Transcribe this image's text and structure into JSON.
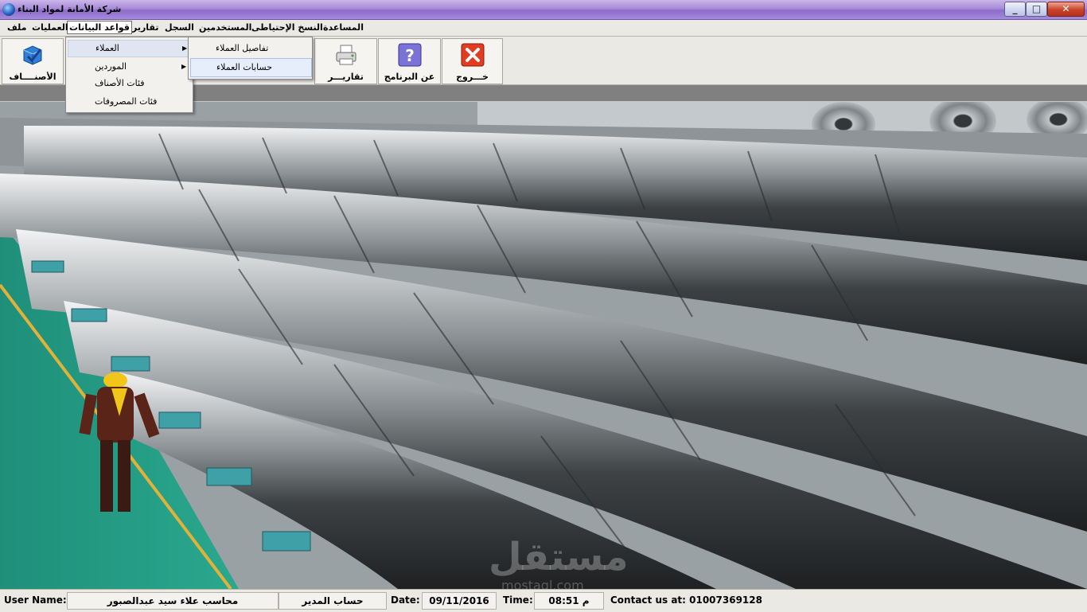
{
  "window": {
    "title": "شركة الأمانة لمواد البناء"
  },
  "menu": {
    "items": [
      "المساعدة",
      "النسخ الإحتياطى",
      "المستخدمين",
      "السجل",
      "تقارير",
      "قواعد البيانات",
      "العمليات",
      "ملف"
    ],
    "active": "قواعد البيانات"
  },
  "toolbar": {
    "exit": "خـــروج",
    "about": "عن البرنامج",
    "reports": "تقاريـــر",
    "items": "الأصنــــاف"
  },
  "dropdown": {
    "items": [
      "العملاء",
      "الموردين",
      "فئات الأصناف",
      "فئات المصروفات"
    ]
  },
  "submenu": {
    "items": [
      "تفاصيل العملاء",
      "حسابات العملاء"
    ]
  },
  "status": {
    "user_label": "User Name:",
    "user_name": "محاسب علاء سيد عبدالصبور",
    "role": "حساب المدير",
    "date_label": "Date:",
    "date": "09/11/2016",
    "time_label": "Time:",
    "time": "08:51 م",
    "contact": "Contact us at: 01007369128"
  },
  "watermark": {
    "text": "مستقل",
    "sub": "mostaql.com"
  },
  "colors": {
    "titlebar": "#a98ad8",
    "close": "#c8432a",
    "menu_bg": "#ebe9e4",
    "strip": "#808080"
  }
}
